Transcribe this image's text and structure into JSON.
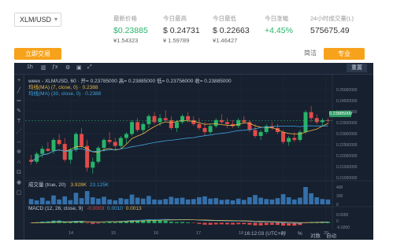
{
  "ticker": {
    "pair": "XLM/USD",
    "stats": [
      {
        "label": "最新价格",
        "value": "$0.23885",
        "sub": "¥1.54323",
        "color": "green"
      },
      {
        "label": "今日最高",
        "value": "$ 0.24731",
        "sub": "¥ 1.59789",
        "color": "dark"
      },
      {
        "label": "今日最低",
        "value": "$ 0.22663",
        "sub": "¥1.46427",
        "color": "dark"
      },
      {
        "label": "今日涨幅",
        "value": "+4.45%",
        "sub": "",
        "color": "green"
      },
      {
        "label": "24小时成交量(L)",
        "value": "575675.49",
        "sub": "",
        "color": "dark"
      }
    ]
  },
  "actions": {
    "buy_label": "立即交易",
    "tab_simple": "简洁",
    "tab_pro": "专业"
  },
  "chart": {
    "toolbar_interval": "1h",
    "reset_label": "重置",
    "ohlc_text": "weex - XLM/USD, 60 · 开= 0.23785000 高= 0.23885000 低= 0.23756000 收= 0.23885000",
    "ma1_label": "均线(MA) (7, close, 0) · 0.2388",
    "ma2_label": "均线(MA) (30, close, 0) · 0.2388",
    "price_tag": "0.23885000",
    "price_axis": [
      "0.25000000",
      "0.24500000",
      "0.24000000",
      "0.23500000",
      "0.23000000",
      "0.22500000",
      "0.22000000",
      "0.21500000",
      "0.21000000"
    ],
    "volume_label": "成交量 (true, 20)",
    "volume_values": [
      "3.928K",
      "23.125K"
    ],
    "volume_axis": [
      "400",
      "200",
      "0"
    ],
    "macd_label": "MACD (12, 26, close, 9)",
    "macd_values": [
      "-0.0003",
      "0.0010",
      "0.0013"
    ],
    "macd_axis": [
      "0.0050",
      "0",
      "-0.0200"
    ],
    "x_labels": [
      "14",
      "15",
      "16",
      "17",
      "18",
      "19",
      "20"
    ],
    "time_text": "16:12:03 (UTC+8)",
    "scale_options": [
      "%",
      "对数",
      "自动"
    ],
    "colors": {
      "up": "#27b36a",
      "down": "#e24b4b",
      "ma7": "#e8b84a",
      "ma30": "#3fa3e0",
      "bg": "#17202e"
    }
  },
  "chart_data": {
    "type": "candlestick",
    "x": [
      "14",
      "15",
      "16",
      "17",
      "18",
      "19",
      "20"
    ],
    "candles": [
      [
        0.219,
        0.2215,
        0.2165,
        0.218
      ],
      [
        0.218,
        0.223,
        0.217,
        0.222
      ],
      [
        0.222,
        0.226,
        0.22,
        0.2245
      ],
      [
        0.2245,
        0.228,
        0.223,
        0.2235
      ],
      [
        0.2235,
        0.23,
        0.222,
        0.229
      ],
      [
        0.229,
        0.232,
        0.226,
        0.227
      ],
      [
        0.227,
        0.23,
        0.218,
        0.219
      ],
      [
        0.219,
        0.225,
        0.217,
        0.224
      ],
      [
        0.224,
        0.233,
        0.223,
        0.232
      ],
      [
        0.232,
        0.235,
        0.225,
        0.226
      ],
      [
        0.226,
        0.229,
        0.213,
        0.215
      ],
      [
        0.215,
        0.22,
        0.212,
        0.218
      ],
      [
        0.218,
        0.226,
        0.217,
        0.225
      ],
      [
        0.225,
        0.23,
        0.223,
        0.229
      ],
      [
        0.229,
        0.233,
        0.227,
        0.228
      ],
      [
        0.228,
        0.23,
        0.224,
        0.226
      ],
      [
        0.226,
        0.231,
        0.225,
        0.23
      ],
      [
        0.23,
        0.233,
        0.227,
        0.232
      ],
      [
        0.232,
        0.239,
        0.231,
        0.238
      ],
      [
        0.238,
        0.24,
        0.233,
        0.234
      ],
      [
        0.234,
        0.238,
        0.232,
        0.237
      ],
      [
        0.237,
        0.242,
        0.235,
        0.241
      ],
      [
        0.241,
        0.243,
        0.237,
        0.238
      ],
      [
        0.238,
        0.242,
        0.236,
        0.24
      ],
      [
        0.24,
        0.244,
        0.238,
        0.239
      ],
      [
        0.239,
        0.241,
        0.234,
        0.235
      ],
      [
        0.235,
        0.239,
        0.233,
        0.238
      ],
      [
        0.238,
        0.242,
        0.237,
        0.241
      ],
      [
        0.241,
        0.243,
        0.238,
        0.239
      ],
      [
        0.239,
        0.241,
        0.236,
        0.237
      ],
      [
        0.237,
        0.24,
        0.234,
        0.235
      ],
      [
        0.235,
        0.238,
        0.231,
        0.233
      ],
      [
        0.233,
        0.237,
        0.232,
        0.236
      ],
      [
        0.236,
        0.24,
        0.235,
        0.239
      ],
      [
        0.239,
        0.242,
        0.237,
        0.238
      ],
      [
        0.238,
        0.24,
        0.235,
        0.237
      ],
      [
        0.237,
        0.239,
        0.235,
        0.236
      ],
      [
        0.236,
        0.24,
        0.235,
        0.239
      ],
      [
        0.239,
        0.241,
        0.237,
        0.238
      ],
      [
        0.238,
        0.239,
        0.233,
        0.234
      ],
      [
        0.234,
        0.237,
        0.23,
        0.231
      ],
      [
        0.231,
        0.234,
        0.229,
        0.233
      ],
      [
        0.233,
        0.237,
        0.232,
        0.236
      ],
      [
        0.236,
        0.238,
        0.234,
        0.235
      ],
      [
        0.235,
        0.237,
        0.232,
        0.233
      ],
      [
        0.233,
        0.234,
        0.227,
        0.228
      ],
      [
        0.228,
        0.231,
        0.226,
        0.23
      ],
      [
        0.23,
        0.233,
        0.228,
        0.229
      ],
      [
        0.229,
        0.234,
        0.228,
        0.233
      ],
      [
        0.233,
        0.244,
        0.232,
        0.243
      ],
      [
        0.243,
        0.246,
        0.238,
        0.24
      ],
      [
        0.24,
        0.242,
        0.237,
        0.238
      ],
      [
        0.238,
        0.24,
        0.236,
        0.239
      ],
      [
        0.239,
        0.24,
        0.237,
        0.2388
      ]
    ],
    "volumes": [
      120,
      90,
      150,
      80,
      200,
      110,
      180,
      95,
      260,
      140,
      300,
      160,
      130,
      170,
      110,
      90,
      140,
      120,
      220,
      150,
      130,
      190,
      110,
      100,
      120,
      170,
      140,
      150,
      110,
      120,
      160,
      180,
      130,
      140,
      100,
      110,
      90,
      130,
      100,
      160,
      210,
      150,
      120,
      110,
      140,
      230,
      160,
      110,
      150,
      390,
      250,
      160,
      120,
      110
    ],
    "ylim": [
      0.21,
      0.252
    ]
  }
}
